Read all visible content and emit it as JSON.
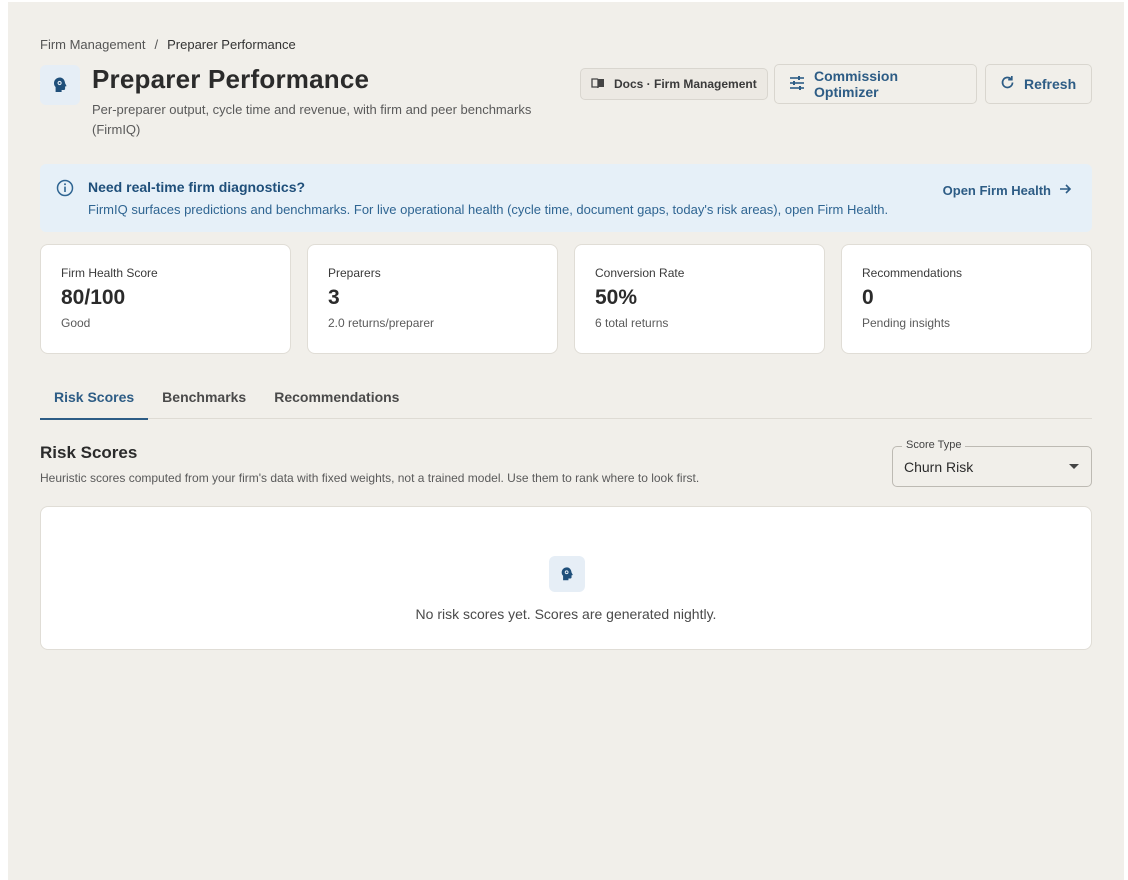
{
  "breadcrumb": {
    "items": [
      "Firm Management",
      "Preparer Performance"
    ],
    "separator": "/"
  },
  "header": {
    "title": "Preparer Performance",
    "subtitle": "Per-preparer output, cycle time and revenue, with firm and peer benchmarks (FirmIQ)",
    "icon": "brain-head-icon"
  },
  "actions": {
    "docs_label": "Docs · Firm Management",
    "commission_label": "Commission Optimizer",
    "refresh_label": "Refresh"
  },
  "alert": {
    "title": "Need real-time firm diagnostics?",
    "text": "FirmIQ surfaces predictions and benchmarks. For live operational health (cycle time, document gaps, today's risk areas), open Firm Health.",
    "link_label": "Open Firm Health"
  },
  "metrics": [
    {
      "label": "Firm Health Score",
      "value": "80/100",
      "sub": "Good"
    },
    {
      "label": "Preparers",
      "value": "3",
      "sub": "2.0 returns/preparer"
    },
    {
      "label": "Conversion Rate",
      "value": "50%",
      "sub": "6 total returns"
    },
    {
      "label": "Recommendations",
      "value": "0",
      "sub": "Pending insights"
    }
  ],
  "tabs": [
    {
      "label": "Risk Scores",
      "active": true
    },
    {
      "label": "Benchmarks",
      "active": false
    },
    {
      "label": "Recommendations",
      "active": false
    }
  ],
  "section": {
    "title": "Risk Scores",
    "description": "Heuristic scores computed from your firm's data with fixed weights, not a trained model. Use them to rank where to look first."
  },
  "score_type": {
    "label": "Score Type",
    "value": "Churn Risk"
  },
  "empty_state": {
    "text": "No risk scores yet. Scores are generated nightly."
  },
  "colors": {
    "accent": "#2d5c85",
    "background": "#f1efea",
    "alert_bg": "#e6f0f8"
  }
}
